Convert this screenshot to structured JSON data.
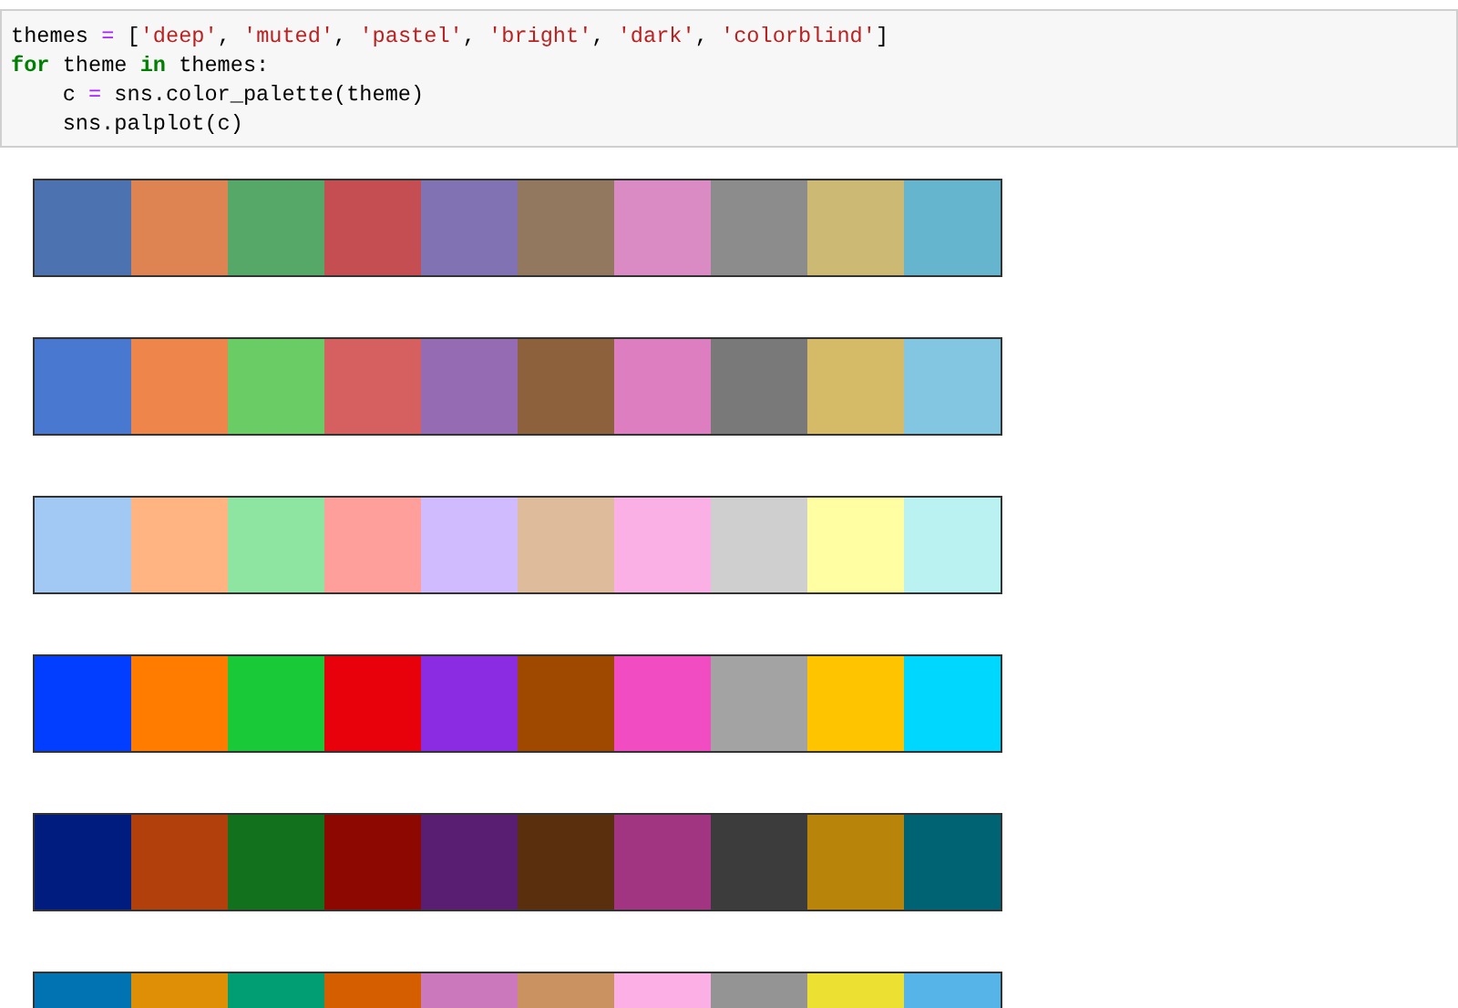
{
  "code_cell": {
    "lines": [
      [
        {
          "kind": "name",
          "text": "themes "
        },
        {
          "kind": "op",
          "text": "="
        },
        {
          "kind": "name",
          "text": " ["
        },
        {
          "kind": "str",
          "text": "'deep'"
        },
        {
          "kind": "name",
          "text": ", "
        },
        {
          "kind": "str",
          "text": "'muted'"
        },
        {
          "kind": "name",
          "text": ", "
        },
        {
          "kind": "str",
          "text": "'pastel'"
        },
        {
          "kind": "name",
          "text": ", "
        },
        {
          "kind": "str",
          "text": "'bright'"
        },
        {
          "kind": "name",
          "text": ", "
        },
        {
          "kind": "str",
          "text": "'dark'"
        },
        {
          "kind": "name",
          "text": ", "
        },
        {
          "kind": "str",
          "text": "'colorblind'"
        },
        {
          "kind": "name",
          "text": "]"
        }
      ],
      [
        {
          "kind": "kw",
          "text": "for"
        },
        {
          "kind": "name",
          "text": " theme "
        },
        {
          "kind": "kw",
          "text": "in"
        },
        {
          "kind": "name",
          "text": " themes:"
        }
      ],
      [
        {
          "kind": "name",
          "text": "    c "
        },
        {
          "kind": "op",
          "text": "="
        },
        {
          "kind": "name",
          "text": " sns.color_palette(theme)"
        }
      ],
      [
        {
          "kind": "name",
          "text": "    sns.palplot(c)"
        }
      ]
    ]
  },
  "palettes": [
    {
      "swatches": [
        {
          "color": "#4c72b0"
        },
        {
          "color": "#dd8452"
        },
        {
          "color": "#55a868"
        },
        {
          "color": "#c44e52"
        },
        {
          "color": "#8172b3"
        },
        {
          "color": "#937860"
        },
        {
          "color": "#da8bc3"
        },
        {
          "color": "#8c8c8c"
        },
        {
          "color": "#ccb974"
        },
        {
          "color": "#64b5cd"
        }
      ]
    },
    {
      "swatches": [
        {
          "color": "#4878d0"
        },
        {
          "color": "#ee854a"
        },
        {
          "color": "#6acc64"
        },
        {
          "color": "#d65f5f"
        },
        {
          "color": "#956cb4"
        },
        {
          "color": "#8c613c"
        },
        {
          "color": "#dc7ec0"
        },
        {
          "color": "#797979"
        },
        {
          "color": "#d5bb67"
        },
        {
          "color": "#82c6e2"
        }
      ]
    },
    {
      "swatches": [
        {
          "color": "#a1c9f4"
        },
        {
          "color": "#ffb482"
        },
        {
          "color": "#8de5a1"
        },
        {
          "color": "#ff9f9b"
        },
        {
          "color": "#d0bbff"
        },
        {
          "color": "#debb9b"
        },
        {
          "color": "#fab0e4"
        },
        {
          "color": "#cfcfcf"
        },
        {
          "color": "#fffea3"
        },
        {
          "color": "#b9f2f0"
        }
      ]
    },
    {
      "swatches": [
        {
          "color": "#023eff"
        },
        {
          "color": "#ff7c00"
        },
        {
          "color": "#1ac938"
        },
        {
          "color": "#e8000b"
        },
        {
          "color": "#8b2be2"
        },
        {
          "color": "#9f4800"
        },
        {
          "color": "#f14cc1"
        },
        {
          "color": "#a3a3a3"
        },
        {
          "color": "#ffc400"
        },
        {
          "color": "#00d7ff"
        }
      ]
    },
    {
      "swatches": [
        {
          "color": "#001c7f"
        },
        {
          "color": "#b1400d"
        },
        {
          "color": "#12711c"
        },
        {
          "color": "#8c0800"
        },
        {
          "color": "#591e71"
        },
        {
          "color": "#592f0d"
        },
        {
          "color": "#a23582"
        },
        {
          "color": "#3c3c3c"
        },
        {
          "color": "#b8850a"
        },
        {
          "color": "#006374"
        }
      ]
    },
    {
      "swatches": [
        {
          "color": "#0173b2"
        },
        {
          "color": "#de8f05"
        },
        {
          "color": "#029e73"
        },
        {
          "color": "#d55e00"
        },
        {
          "color": "#cc78bc"
        },
        {
          "color": "#ca9161"
        },
        {
          "color": "#fbafe4"
        },
        {
          "color": "#949494"
        },
        {
          "color": "#ece133"
        },
        {
          "color": "#56b4e9"
        }
      ]
    }
  ]
}
